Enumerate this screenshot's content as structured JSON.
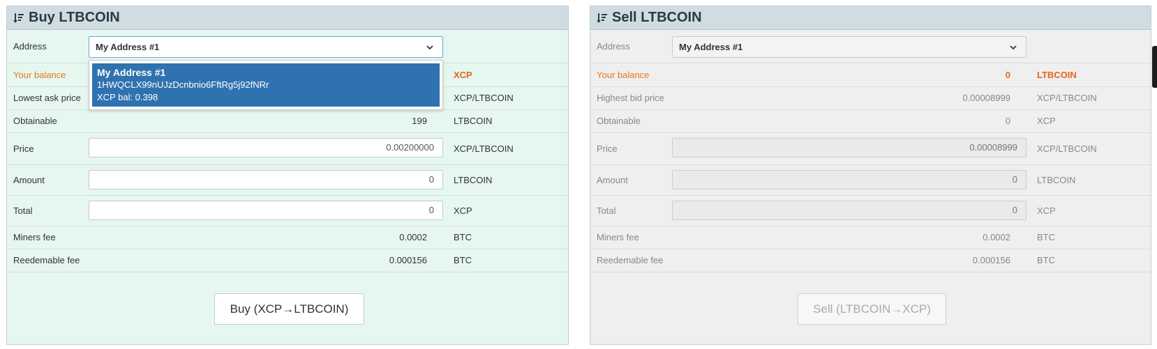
{
  "buy": {
    "title": "Buy LTBCOIN",
    "header_icon": "sort-descending-icon",
    "address_label": "Address",
    "address_selected": "My Address #1",
    "dropdown_option": {
      "name": "My Address #1",
      "address": "1HWQCLX99nUJzDcnbnio6FftRg5j92fNRr",
      "balance": "XCP bal: 0.398"
    },
    "balance_label": "Your balance",
    "balance_unit": "XCP",
    "lowest_ask_label": "Lowest ask price",
    "lowest_ask_unit": "XCP/LTBCOIN",
    "obtainable_label": "Obtainable",
    "obtainable_value": "199",
    "obtainable_unit": "LTBCOIN",
    "price_label": "Price",
    "price_value": "0.00200000",
    "price_unit": "XCP/LTBCOIN",
    "amount_label": "Amount",
    "amount_value": "0",
    "amount_unit": "LTBCOIN",
    "total_label": "Total",
    "total_value": "0",
    "total_unit": "XCP",
    "miners_fee_label": "Miners fee",
    "miners_fee_value": "0.0002",
    "miners_fee_unit": "BTC",
    "redeemable_fee_label": "Reedemable fee",
    "redeemable_fee_value": "0.000156",
    "redeemable_fee_unit": "BTC",
    "button_label": "Buy (XCP→LTBCOIN)"
  },
  "sell": {
    "title": "Sell LTBCOIN",
    "header_icon": "sort-descending-icon",
    "address_label": "Address",
    "address_selected": "My Address #1",
    "balance_label": "Your balance",
    "balance_value": "0",
    "balance_unit": "LTBCOIN",
    "highest_bid_label": "Highest bid price",
    "highest_bid_value": "0.00008999",
    "highest_bid_unit": "XCP/LTBCOIN",
    "obtainable_label": "Obtainable",
    "obtainable_value": "0",
    "obtainable_unit": "XCP",
    "price_label": "Price",
    "price_value": "0.00008999",
    "price_unit": "XCP/LTBCOIN",
    "amount_label": "Amount",
    "amount_value": "0",
    "amount_unit": "LTBCOIN",
    "total_label": "Total",
    "total_value": "0",
    "total_unit": "XCP",
    "miners_fee_label": "Miners fee",
    "miners_fee_value": "0.0002",
    "miners_fee_unit": "BTC",
    "redeemable_fee_label": "Reedemable fee",
    "redeemable_fee_value": "0.000156",
    "redeemable_fee_unit": "BTC",
    "button_label": "Sell (LTBCOIN→XCP)"
  },
  "colors": {
    "buy_background": "#e5f7ef",
    "sell_background": "#efefef",
    "header_background": "#cfdde3",
    "balance_accent": "#e8641c",
    "dropdown_highlight": "#2f72b0"
  }
}
